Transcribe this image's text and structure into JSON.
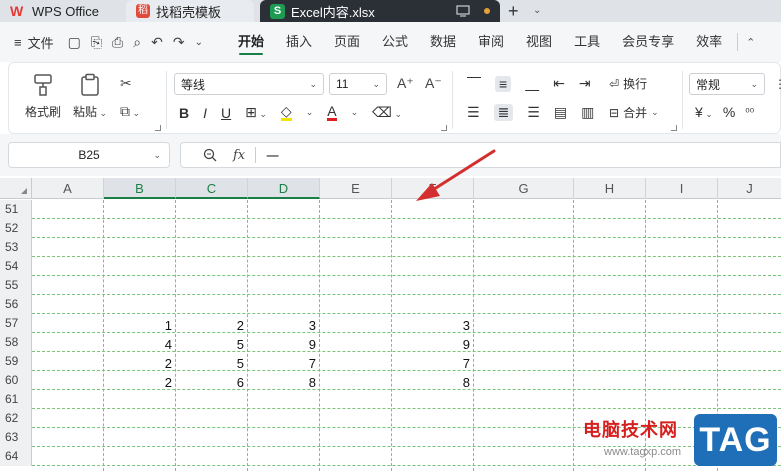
{
  "titlebar": {
    "tabs": [
      {
        "label": "WPS Office"
      },
      {
        "label": "找稻壳模板"
      },
      {
        "label": "Excel内容.xlsx"
      }
    ]
  },
  "menubar": {
    "file_label": "文件",
    "items": [
      "开始",
      "插入",
      "页面",
      "公式",
      "数据",
      "审阅",
      "视图",
      "工具",
      "会员专享",
      "效率"
    ]
  },
  "ribbon": {
    "format_painter": "格式刷",
    "paste": "粘贴",
    "font_name": "等线",
    "font_size": "11",
    "wrap": "换行",
    "merge": "合并",
    "number_format": "常规",
    "currency_symbol": "¥",
    "percent_symbol": "%"
  },
  "formula_bar": {
    "cell_ref": "B25",
    "fx_label": "fx",
    "content": "一"
  },
  "grid": {
    "columns": [
      "A",
      "B",
      "C",
      "D",
      "E",
      "F",
      "G",
      "H",
      "I",
      "J"
    ],
    "rows": [
      "51",
      "52",
      "53",
      "54",
      "55",
      "56",
      "57",
      "58",
      "59",
      "60",
      "61",
      "62",
      "63",
      "64"
    ],
    "data": [
      {
        "row": "57",
        "B": "1",
        "C": "2",
        "D": "3",
        "F": "3"
      },
      {
        "row": "58",
        "B": "4",
        "C": "5",
        "D": "9",
        "F": "9"
      },
      {
        "row": "59",
        "B": "2",
        "C": "5",
        "D": "7",
        "F": "7"
      },
      {
        "row": "60",
        "B": "2",
        "C": "6",
        "D": "8",
        "F": "8"
      }
    ]
  },
  "watermark": {
    "text": "电脑技术网",
    "url": "www.tagxp.com",
    "badge": "TAG"
  },
  "colors": {
    "accent": "#1a7f46",
    "gridline": "#7ac47a",
    "annotation_arrow": "#d32f2f"
  }
}
